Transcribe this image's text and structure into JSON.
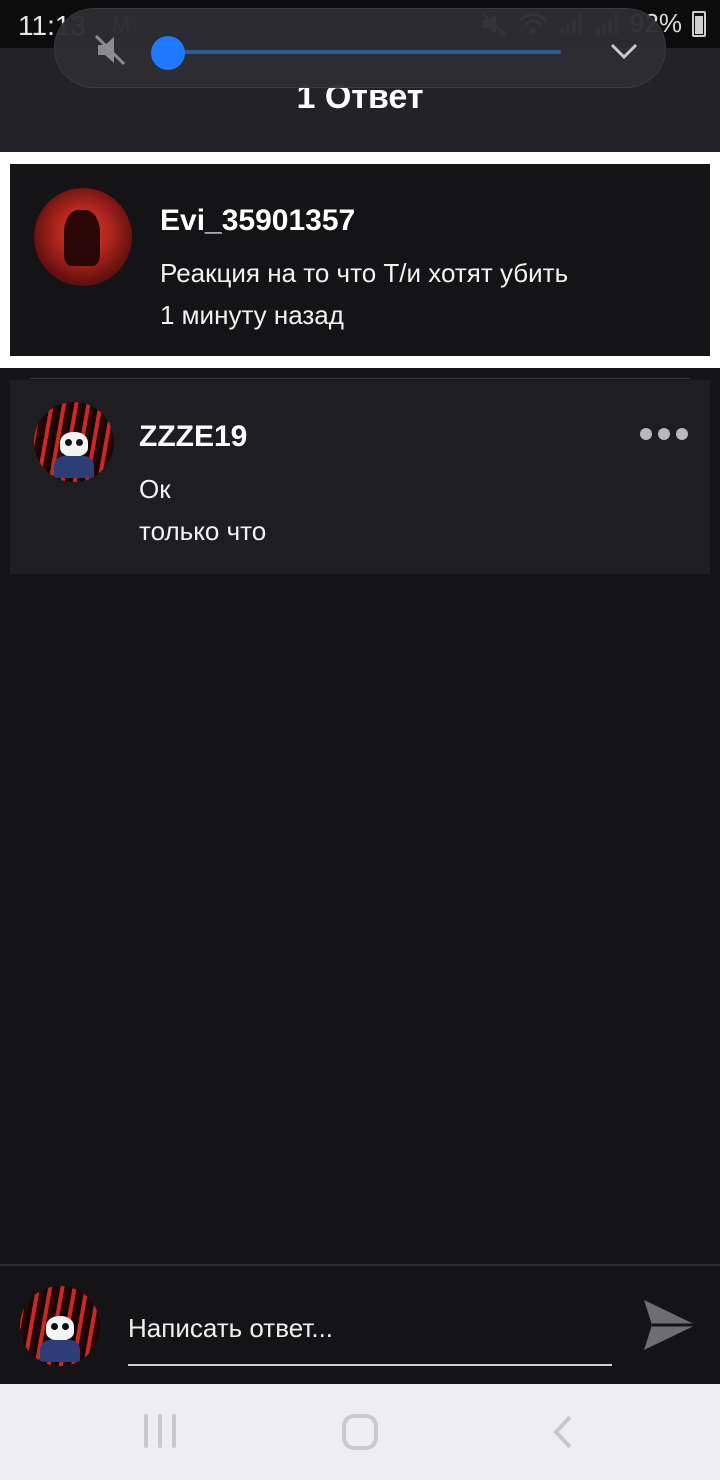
{
  "status_bar": {
    "time": "11:13",
    "mail_icon": "M",
    "battery": "92%"
  },
  "header": {
    "title": "1 Ответ"
  },
  "volume_panel": {
    "muted": true,
    "level": 0.0,
    "accent_color": "#1f7aff"
  },
  "original_comment": {
    "username": "Evi_35901357",
    "text": "Реакция на то что Т/и хотят убить",
    "time": "1 минуту назад",
    "avatar": "red-moon-avatar"
  },
  "reply": {
    "username": "ZZZE19",
    "text": "Ок",
    "time": "только что",
    "avatar": "skull-avatar",
    "menu_icon": "more-dots-icon"
  },
  "composer": {
    "placeholder": "Написать ответ...",
    "send_icon": "send-icon"
  },
  "nav": {
    "recent_icon": "recent-apps-icon",
    "home_icon": "home-icon",
    "back_icon": "back-icon"
  }
}
